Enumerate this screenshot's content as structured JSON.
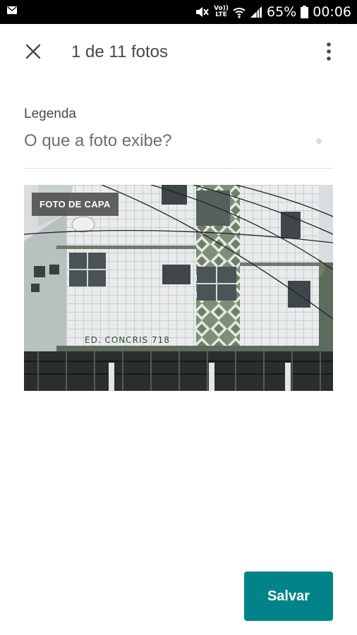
{
  "status_bar": {
    "battery_percent": "65%",
    "time": "00:06",
    "network_label": "Vo)) LTE",
    "icons": [
      "mail-icon",
      "mute-icon",
      "wifi-icon",
      "signal-icon",
      "battery-icon"
    ]
  },
  "header": {
    "title": "1 de 11 fotos",
    "close_icon": "close-icon",
    "menu_icon": "more-vertical-icon"
  },
  "caption": {
    "label": "Legenda",
    "placeholder": "O que a foto exibe?",
    "value": ""
  },
  "photo": {
    "badge": "FOTO DE CAPA",
    "sign_text": "ED. CONCRIS 718"
  },
  "actions": {
    "save_label": "Salvar"
  },
  "colors": {
    "accent": "#008489",
    "text": "#484848",
    "status_bar": "#000000",
    "divider": "#dddddd"
  }
}
